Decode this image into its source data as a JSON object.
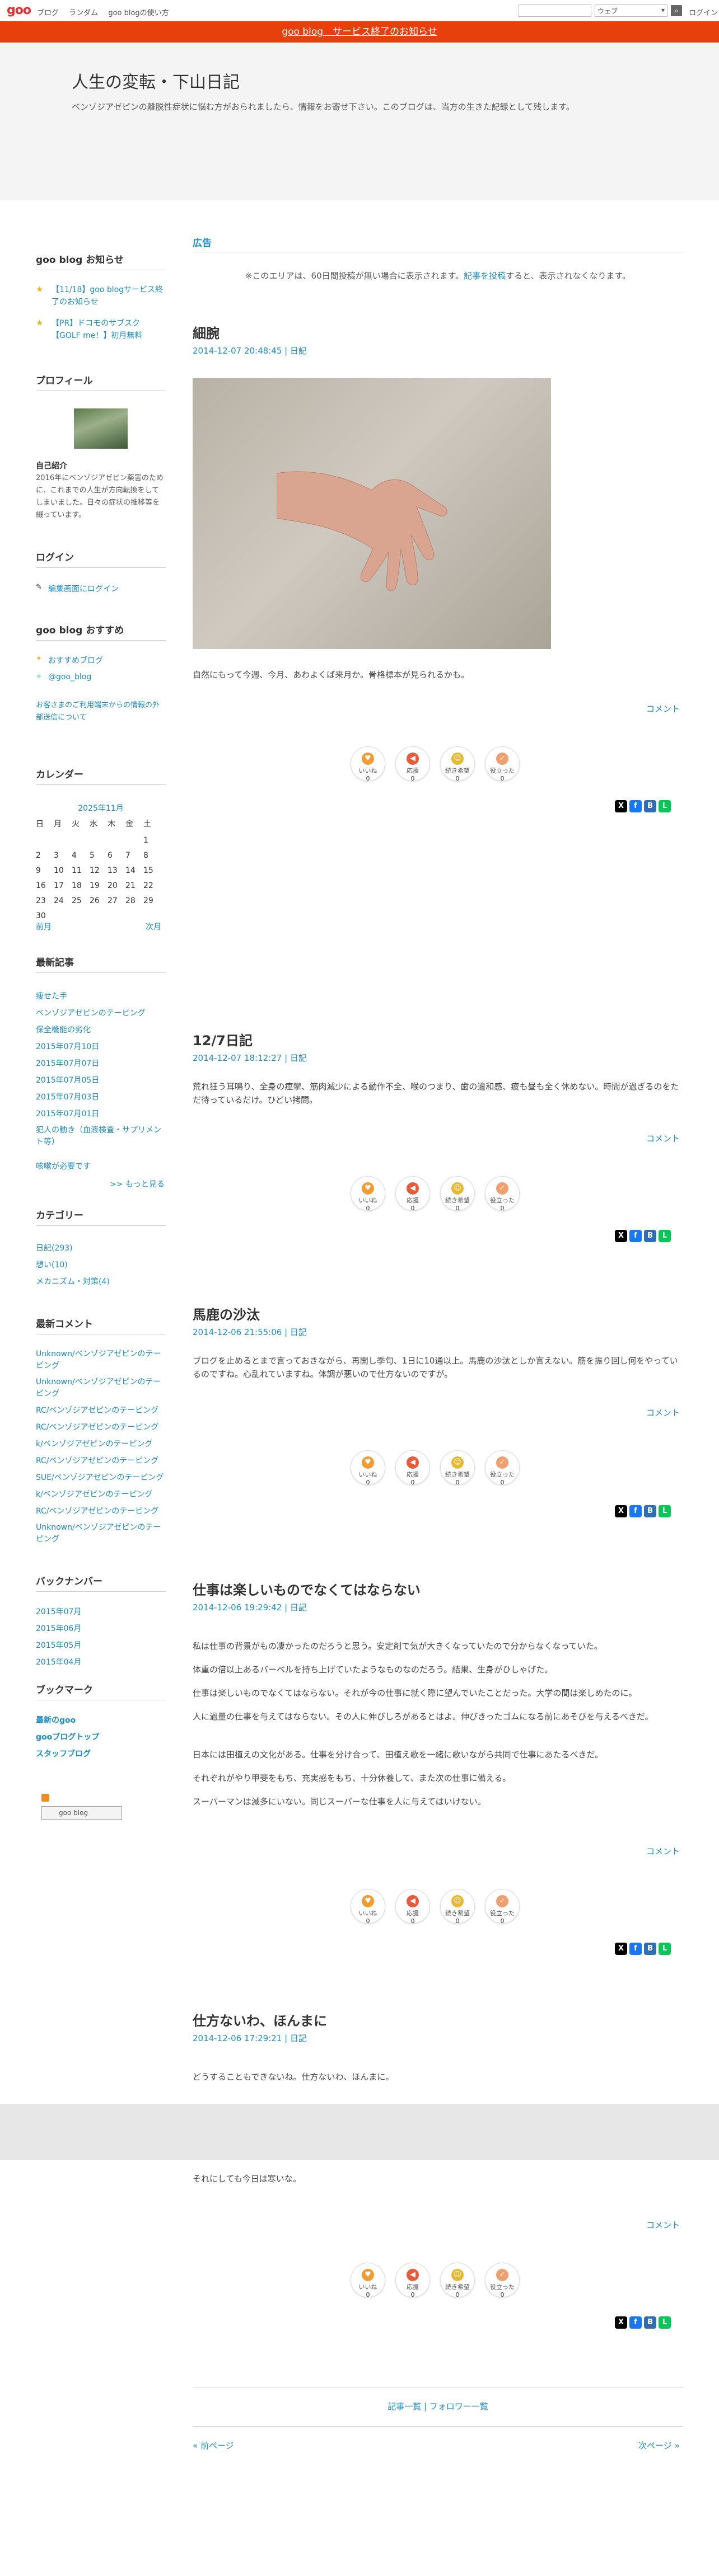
{
  "topbar": {
    "logo": "goo",
    "links": [
      "ブログ",
      "ランダム",
      "goo blogの使い方"
    ],
    "search_placeholder": "",
    "search_scope": "ウェブ",
    "login": "ログイン"
  },
  "notice": "goo blog　サービス終了のお知らせ",
  "header": {
    "title": "人生の変転・下山日記",
    "description": "ベンゾジアゼピンの離脱性症状に悩む方がおられましたら、情報をお寄せ下さい。このブログは、当方の生きた記録として残します。"
  },
  "sidebar": {
    "notice_title": "goo blog お知らせ",
    "notices": [
      "【11/18】goo blogサービス終了のお知らせ",
      "【PR】ドコモのサブスク【GOLF me！】初月無料"
    ],
    "profile_title": "プロフィール",
    "profile_label": "自己紹介",
    "profile_text": "2016年にベンゾジアゼピン薬害のために、これまでの人生が方向転換をしてしまいました。日々の症状の推移等を綴っています。",
    "login_title": "ログイン",
    "login_link": "編集画面にログイン",
    "recommend_title": "goo blog おすすめ",
    "recommend_links": [
      "おすすめブログ",
      "@goo_blog"
    ],
    "recommend_note": "お客さまのご利用端末からの情報の外部送信について",
    "calendar_title": "カレンダー",
    "calendar_month": "2025年11月",
    "calendar_days": [
      "日",
      "月",
      "火",
      "水",
      "木",
      "金",
      "土"
    ],
    "calendar_weeks": [
      [
        "",
        "",
        "",
        "",
        "",
        "",
        "1"
      ],
      [
        "2",
        "3",
        "4",
        "5",
        "6",
        "7",
        "8"
      ],
      [
        "9",
        "10",
        "11",
        "12",
        "13",
        "14",
        "15"
      ],
      [
        "16",
        "17",
        "18",
        "19",
        "20",
        "21",
        "22"
      ],
      [
        "23",
        "24",
        "25",
        "26",
        "27",
        "28",
        "29"
      ],
      [
        "30",
        "",
        "",
        "",
        "",
        "",
        ""
      ]
    ],
    "calendar_prev": "前月",
    "calendar_next": "次月",
    "recent_title": "最新記事",
    "recent_posts": [
      "痩せた手",
      "ベンゾジアゼピンのテーピング",
      "保全機能の劣化",
      "2015年07月10日",
      "2015年07月07日",
      "2015年07月05日",
      "2015年07月03日",
      "2015年07月01日",
      "犯人の動き（血液検査・サプリメント等）",
      "咳嗽が必要です"
    ],
    "more_link": ">> もっと見る",
    "category_title": "カテゴリー",
    "categories": [
      "日記(293)",
      "想い(10)",
      "メカニズム・対策(4)"
    ],
    "comments_title": "最新コメント",
    "comments": [
      "Unknown/ベンゾジアゼピンのテーピング",
      "Unknown/ベンゾジアゼピンのテーピング",
      "RC/ベンゾジアゼピンのテーピング",
      "RC/ベンゾジアゼピンのテーピング",
      "k/ベンゾジアゼピンのテーピング",
      "RC/ベンゾジアゼピンのテーピング",
      "SUE/ベンゾジアゼピンのテーピング",
      "k/ベンゾジアゼピンのテーピング",
      "RC/ベンゾジアゼピンのテーピング",
      "Unknown/ベンゾジアゼピンのテーピング"
    ],
    "backnumber_title": "バックナンバー",
    "backnumbers": [
      "2015年07月",
      "2015年06月",
      "2015年05月",
      "2015年04月"
    ],
    "bookmark_title": "ブックマーク",
    "bookmarks": [
      "最新のgoo",
      "gooブログトップ",
      "スタッフブログ"
    ],
    "badge": "goo blog"
  },
  "main": {
    "ad_label": "広告",
    "ad_note_pre": "※このエリアは、60日間投稿が無い場合に表示されます。",
    "ad_note_link": "記事を投稿",
    "ad_note_post": "すると、表示されなくなります。",
    "comment_label": "コメント",
    "reactions": [
      {
        "label": "いいね",
        "count": "0",
        "color": "#f29b30",
        "icon": "heart-icon"
      },
      {
        "label": "応援",
        "count": "0",
        "color": "#e85a3c",
        "icon": "megaphone-icon"
      },
      {
        "label": "続き希望",
        "count": "0",
        "color": "#e8b830",
        "icon": "face-icon"
      },
      {
        "label": "役立った",
        "count": "0",
        "color": "#f0a070",
        "icon": "thumb-icon"
      }
    ],
    "posts": [
      {
        "title": "細腕",
        "date": "2014-12-07 20:48:45",
        "category": "日記",
        "body": [
          "自然にもって今週、今月、あわよくば来月か。骨格標本が見られるかも。"
        ]
      },
      {
        "title": "12/7日記",
        "date": "2014-12-07 18:12:27",
        "category": "日記",
        "body": [
          "荒れ狂う耳鳴り、全身の痙攣、筋肉減少による動作不全、喉のつまり、歯の違和感、疲も昼も全く休めない。時間が過ぎるのをただ待っているだけ。ひどい拷問。"
        ]
      },
      {
        "title": "馬鹿の沙汰",
        "date": "2014-12-06 21:55:06",
        "category": "日記",
        "body": [
          "ブログを止めるとまで言っておきながら、再開し季句、1日に10通以上。馬鹿の沙汰としか言えない。筋を振り回し何をやっているのですね。心乱れていますね。体調が悪いので仕方ないのですが。"
        ]
      },
      {
        "title": "仕事は楽しいものでなくてはならない",
        "date": "2014-12-06 19:29:42",
        "category": "日記",
        "body": [
          "私は仕事の背景がもの凄かったのだろうと思う。安定剤で気が大きくなっていたので分からなくなっていた。",
          "体重の倍以上あるバーベルを持ち上げていたようなものなのだろう。結果、生身がひしゃげた。",
          "仕事は楽しいものでなくてはならない。それが今の仕事に就く際に望んでいたことだった。大学の間は楽しめたのに。",
          "人に過量の仕事を与えてはならない。その人に伸びしろがあるとはよ。伸びきったゴムになる前にあそびを与えるべきだ。",
          "日本には田植えの文化がある。仕事を分け合って、田植え歌を一緒に歌いながら共同で仕事にあたるべきだ。",
          "それぞれがやり甲斐をもち、充実感をもち、十分休養して、また次の仕事に備える。",
          "スーパーマンは滅多にいない。同じスーパーな仕事を人に与えてはいけない。"
        ]
      },
      {
        "title": "仕方ないわ、ほんまに",
        "date": "2014-12-06 17:29:21",
        "category": "日記",
        "body": [
          "どうすることもできないね。仕方ないわ、ほんまに。",
          "それにしても今日は寒いな。"
        ]
      }
    ],
    "footer_links": [
      "記事一覧",
      "フォロワー一覧"
    ],
    "prev_page": "« 前ページ",
    "next_page": "次ページ »"
  }
}
